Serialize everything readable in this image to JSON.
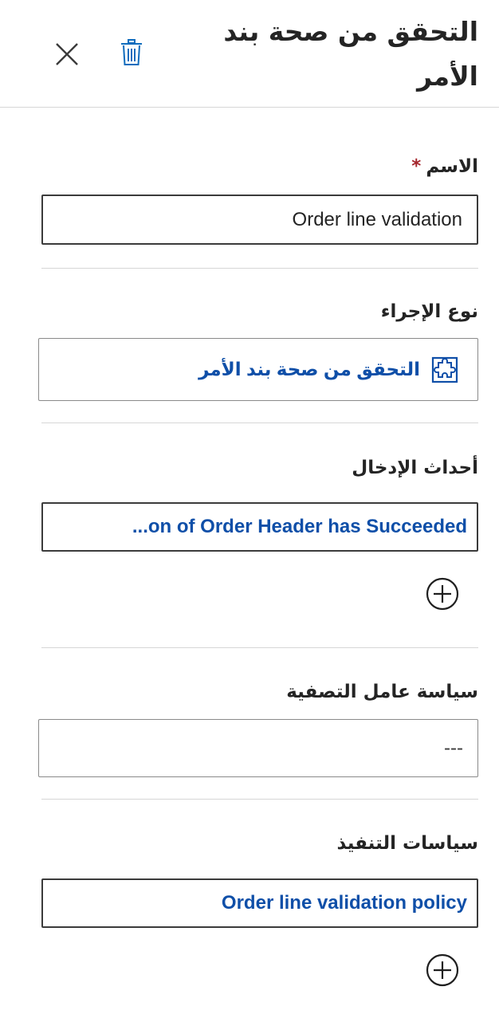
{
  "header": {
    "title_line1": "التحقق من صحة بند",
    "title_line2": "الأمر"
  },
  "icons": {
    "close": "close-icon",
    "delete": "trash-icon",
    "action_type": "puzzle-icon",
    "add": "add-circle-icon"
  },
  "colors": {
    "accent": "#0f4fa8",
    "required": "#a4262c",
    "divider": "#d6d6d6"
  },
  "name_field": {
    "label": "الاسم",
    "required_mark": "*",
    "value": "Order line validation"
  },
  "action_type": {
    "label": "نوع الإجراء",
    "value": "التحقق من صحة بند الأمر"
  },
  "input_events": {
    "label": "أحداث الإدخال",
    "value": "...on of Order Header has Succeeded"
  },
  "filter_policy": {
    "label": "سياسة عامل التصفية",
    "value": "---"
  },
  "execution_policies": {
    "label": "سياسات التنفيذ",
    "value": "Order line validation policy"
  }
}
